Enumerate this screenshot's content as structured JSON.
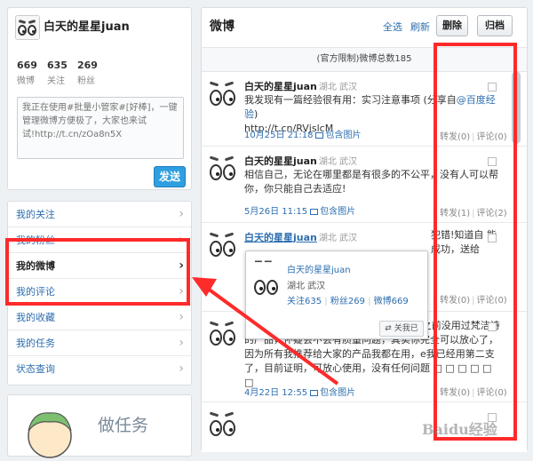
{
  "profile": {
    "name": "白天的星星juan",
    "stats": [
      {
        "num": "669",
        "label": "微博"
      },
      {
        "num": "635",
        "label": "关注"
      },
      {
        "num": "269",
        "label": "粉丝"
      }
    ],
    "compose_placeholder": "我正在使用#批量小管家#[好棒]，一键管理微博方便极了，大家也来试试!http://t.cn/zOa8n5X",
    "send_label": "发送"
  },
  "nav": {
    "items": [
      {
        "label": "我的关注"
      },
      {
        "label": "我的粉丝"
      },
      {
        "label": "我的微博"
      },
      {
        "label": "我的评论"
      },
      {
        "label": "我的收藏"
      },
      {
        "label": "我的任务"
      },
      {
        "label": "状态查询"
      }
    ],
    "chevron": "›"
  },
  "task_title": "做任务",
  "main": {
    "title": "微博",
    "select_all": "全选",
    "refresh": "刷新",
    "delete_label": "删除",
    "archive_label": "归档",
    "notice": "(官方限制)微博总数185"
  },
  "posts": [
    {
      "name": "白天的星星juan",
      "location": "湖北 武汉",
      "text": "我发现有一篇经验很有用：实习注意事项 (分享自",
      "link": "@百度经验",
      "text_end": ")",
      "text2": "http://t.cn/RVjslcM",
      "time": "10月25日 21:18",
      "img_label": "包含图片",
      "repost": "转发(0)",
      "comment": "评论(0)"
    },
    {
      "name": "白天的星星juan",
      "location": "湖北 武汉",
      "text": "相信自己，无论在哪里都是有很多的不公平，没有人可以帮你，你只能自己去适应!",
      "time": "5月26日 11:15",
      "img_label": "包含图片",
      "repost": "转发(1)",
      "comment": "评论(2)"
    },
    {
      "name": "白天的星星juan",
      "location": "湖北 武汉",
      "text": "",
      "text_right": "犯错!知道自 能成功，送给",
      "time": "",
      "img_label": "",
      "repost": "转发(0)",
      "comment": "评论(0)"
    },
    {
      "name": "白天的星星juan",
      "location": "湖北 武汉",
      "text": "#如何购买防尘保护罩好。 也评你还在想之前没用过梵洁诗的产品，怀疑会不会有质量问题，其实你完全可以放心了，因为所有我推荐给大家的产品我都在用，e我已经用第二支了，目前证明，可放心使用，没有任何问题 □ □ □ □ □ □",
      "time": "4月22日 12:55",
      "img_label": "包含图片",
      "repost": "转发(0)",
      "comment": "评论(0)"
    }
  ],
  "popup": {
    "name": "白天的星星juan",
    "location": "湖北 武汉",
    "follow": "关注635",
    "fans": "粉丝269",
    "weibo": "微博669",
    "follow_me": "关我已"
  },
  "watermark": "Baidu经验",
  "colors": {
    "accent": "#2c6eaf",
    "send": "#2f9fe0",
    "annotation": "#ff2a2a"
  }
}
